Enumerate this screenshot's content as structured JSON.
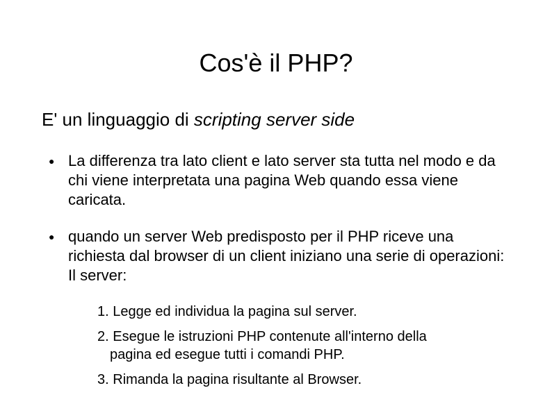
{
  "title": "Cos'è il PHP?",
  "subtitle_prefix": "E' un linguaggio di ",
  "subtitle_italic": "scripting server side",
  "bullets": [
    "La differenza tra lato client e lato server sta tutta nel modo e da chi viene interpretata una pagina Web quando essa viene caricata.",
    "quando un server Web predisposto per il PHP riceve una richiesta dal browser di un client iniziano una serie di operazioni: Il server:"
  ],
  "numbered": [
    {
      "n": "1.",
      "text": "Legge ed individua la pagina sul server."
    },
    {
      "n": "2.",
      "text_line1": "Esegue le istruzioni PHP contenute all'interno della",
      "text_line2": "pagina ed esegue tutti i comandi PHP."
    },
    {
      "n": "3.",
      "text": "Rimanda la pagina risultante al Browser."
    }
  ]
}
